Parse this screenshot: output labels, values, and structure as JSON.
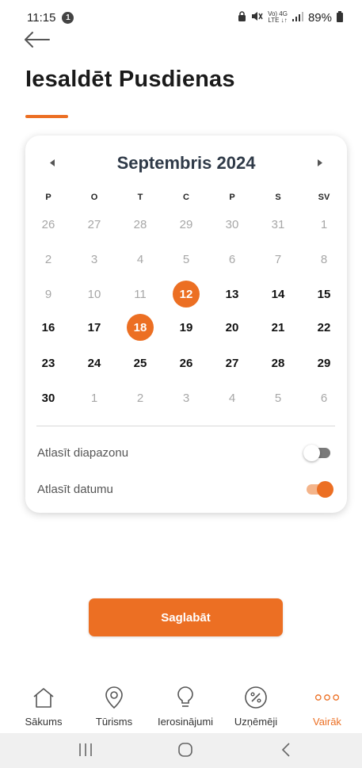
{
  "status_bar": {
    "time": "11:15",
    "notification_count": "1",
    "network_top": "Vo) 4G",
    "network_bottom": "LTE ↓↑",
    "battery": "89%"
  },
  "page": {
    "title": "Iesaldēt Pusdienas"
  },
  "calendar": {
    "month_label": "Septembris 2024",
    "weekdays": [
      "P",
      "O",
      "T",
      "C",
      "P",
      "S",
      "SV"
    ],
    "weeks": [
      [
        {
          "d": "26",
          "m": true
        },
        {
          "d": "27",
          "m": true
        },
        {
          "d": "28",
          "m": true
        },
        {
          "d": "29",
          "m": true
        },
        {
          "d": "30",
          "m": true
        },
        {
          "d": "31",
          "m": true
        },
        {
          "d": "1",
          "m": true
        }
      ],
      [
        {
          "d": "2",
          "m": true
        },
        {
          "d": "3",
          "m": true
        },
        {
          "d": "4",
          "m": true
        },
        {
          "d": "5",
          "m": true
        },
        {
          "d": "6",
          "m": true
        },
        {
          "d": "7",
          "m": true
        },
        {
          "d": "8",
          "m": true
        }
      ],
      [
        {
          "d": "9",
          "m": true
        },
        {
          "d": "10",
          "m": true
        },
        {
          "d": "11",
          "m": true
        },
        {
          "d": "12",
          "s": true
        },
        {
          "d": "13"
        },
        {
          "d": "14"
        },
        {
          "d": "15"
        }
      ],
      [
        {
          "d": "16"
        },
        {
          "d": "17"
        },
        {
          "d": "18",
          "s": true
        },
        {
          "d": "19"
        },
        {
          "d": "20"
        },
        {
          "d": "21"
        },
        {
          "d": "22"
        }
      ],
      [
        {
          "d": "23"
        },
        {
          "d": "24"
        },
        {
          "d": "25"
        },
        {
          "d": "26"
        },
        {
          "d": "27"
        },
        {
          "d": "28"
        },
        {
          "d": "29"
        }
      ],
      [
        {
          "d": "30"
        },
        {
          "d": "1",
          "m": true
        },
        {
          "d": "2",
          "m": true
        },
        {
          "d": "3",
          "m": true
        },
        {
          "d": "4",
          "m": true
        },
        {
          "d": "5",
          "m": true
        },
        {
          "d": "6",
          "m": true
        }
      ]
    ],
    "options": [
      {
        "label": "Atlasīt diapazonu",
        "enabled": false
      },
      {
        "label": "Atlasīt datumu",
        "enabled": true
      }
    ]
  },
  "save_button": {
    "label": "Saglabāt"
  },
  "bottom_nav": {
    "items": [
      {
        "label": "Sākums",
        "icon": "home-icon"
      },
      {
        "label": "Tūrisms",
        "icon": "location-pin-icon"
      },
      {
        "label": "Ierosinājumi",
        "icon": "lightbulb-icon"
      },
      {
        "label": "Uzņēmēji",
        "icon": "percent-icon"
      },
      {
        "label": "Vairāk",
        "icon": "more-dots-icon",
        "active": true
      }
    ]
  },
  "colors": {
    "accent": "#ec6f23",
    "title_text": "#2f3a48",
    "muted_day": "#a7a7a7"
  }
}
